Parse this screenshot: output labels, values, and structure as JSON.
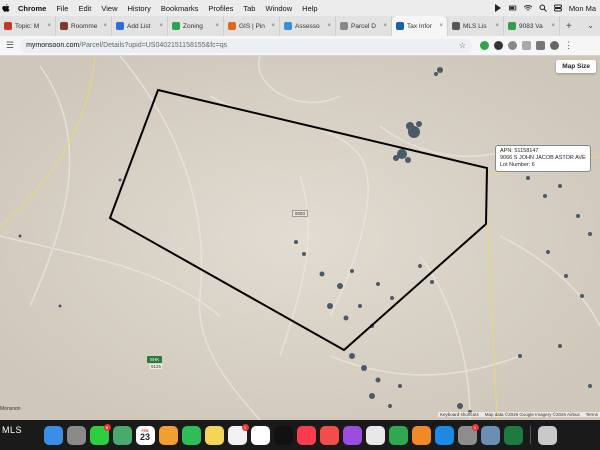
{
  "menubar": {
    "app": "Chrome",
    "items": [
      "File",
      "Edit",
      "View",
      "History",
      "Bookmarks",
      "Profiles",
      "Tab",
      "Window",
      "Help"
    ],
    "clock": "Mon Ma"
  },
  "tabs": [
    {
      "label": "Topic: M",
      "color": "#c0392b",
      "active": false
    },
    {
      "label": "Roomme",
      "color": "#7a3b2e",
      "active": false
    },
    {
      "label": "Add List",
      "color": "#2f6bd8",
      "active": false
    },
    {
      "label": "Zoning",
      "color": "#2ea44f",
      "active": false
    },
    {
      "label": "GIS | Pin",
      "color": "#d86b1f",
      "active": false
    },
    {
      "label": "Assesso",
      "color": "#3a8fd6",
      "active": false
    },
    {
      "label": "Parcel D",
      "color": "#888888",
      "active": false
    },
    {
      "label": "Tax Infor",
      "color": "#1f5fa8",
      "active": true
    },
    {
      "label": "MLS Lis",
      "color": "#555555",
      "active": false
    },
    {
      "label": "9083 Va",
      "color": "#3b9a48",
      "active": false
    }
  ],
  "address": {
    "host": "mymonsoon.com",
    "path": "/Parcel/Details?upid=US0402151158155&fc=qs"
  },
  "map": {
    "size_button": "Map Size",
    "callout": {
      "apn": "APN: 51158147",
      "address": "9066 S JOHN JACOB ASTOR AVE",
      "lot": "Lot Number: 6"
    },
    "lot_label": "9083",
    "highway_shield": "SHK",
    "highway_number": "9125",
    "town": "Monsoon",
    "attribution": [
      "Keyboard shortcuts",
      "Map data ©2026 Google Imagery ©2026 Airbus",
      "Terms"
    ],
    "polygon_color": "#000000"
  },
  "dock": {
    "calendar_month": "FEB",
    "calendar_day": "23",
    "watermark": "MLS",
    "apps": [
      {
        "name": "finder-icon",
        "color": "#3a8ee6"
      },
      {
        "name": "launchpad-icon",
        "color": "#8a8a8a"
      },
      {
        "name": "messages-icon",
        "color": "#2ecc40",
        "badge": "9"
      },
      {
        "name": "maps-icon",
        "color": "#4aa96c"
      },
      {
        "name": "photos-icon",
        "color": "#f0a030"
      },
      {
        "name": "facetime-icon",
        "color": "#2ebd59"
      },
      {
        "name": "notes-icon",
        "color": "#f5d45a"
      },
      {
        "name": "reminders-icon",
        "color": "#f2f2f2",
        "badge": "1"
      },
      {
        "name": "freeform-icon",
        "color": "#ffffff"
      },
      {
        "name": "tv-icon",
        "color": "#111111"
      },
      {
        "name": "music-icon",
        "color": "#fa3c4c"
      },
      {
        "name": "news-icon",
        "color": "#f24c4c"
      },
      {
        "name": "podcasts-icon",
        "color": "#9b4de0"
      },
      {
        "name": "chrome-icon",
        "color": "#e8e8e8"
      },
      {
        "name": "numbers-icon",
        "color": "#2fa84f"
      },
      {
        "name": "pages-icon",
        "color": "#f08a24"
      },
      {
        "name": "appstore-icon",
        "color": "#1e88e5"
      },
      {
        "name": "settings-icon",
        "color": "#8d8d8d",
        "badge": "1"
      },
      {
        "name": "preview-icon",
        "color": "#6b8fb0"
      },
      {
        "name": "excel-icon",
        "color": "#1e7a3f"
      },
      {
        "name": "trash-icon",
        "color": "#c9c9c9"
      }
    ]
  }
}
